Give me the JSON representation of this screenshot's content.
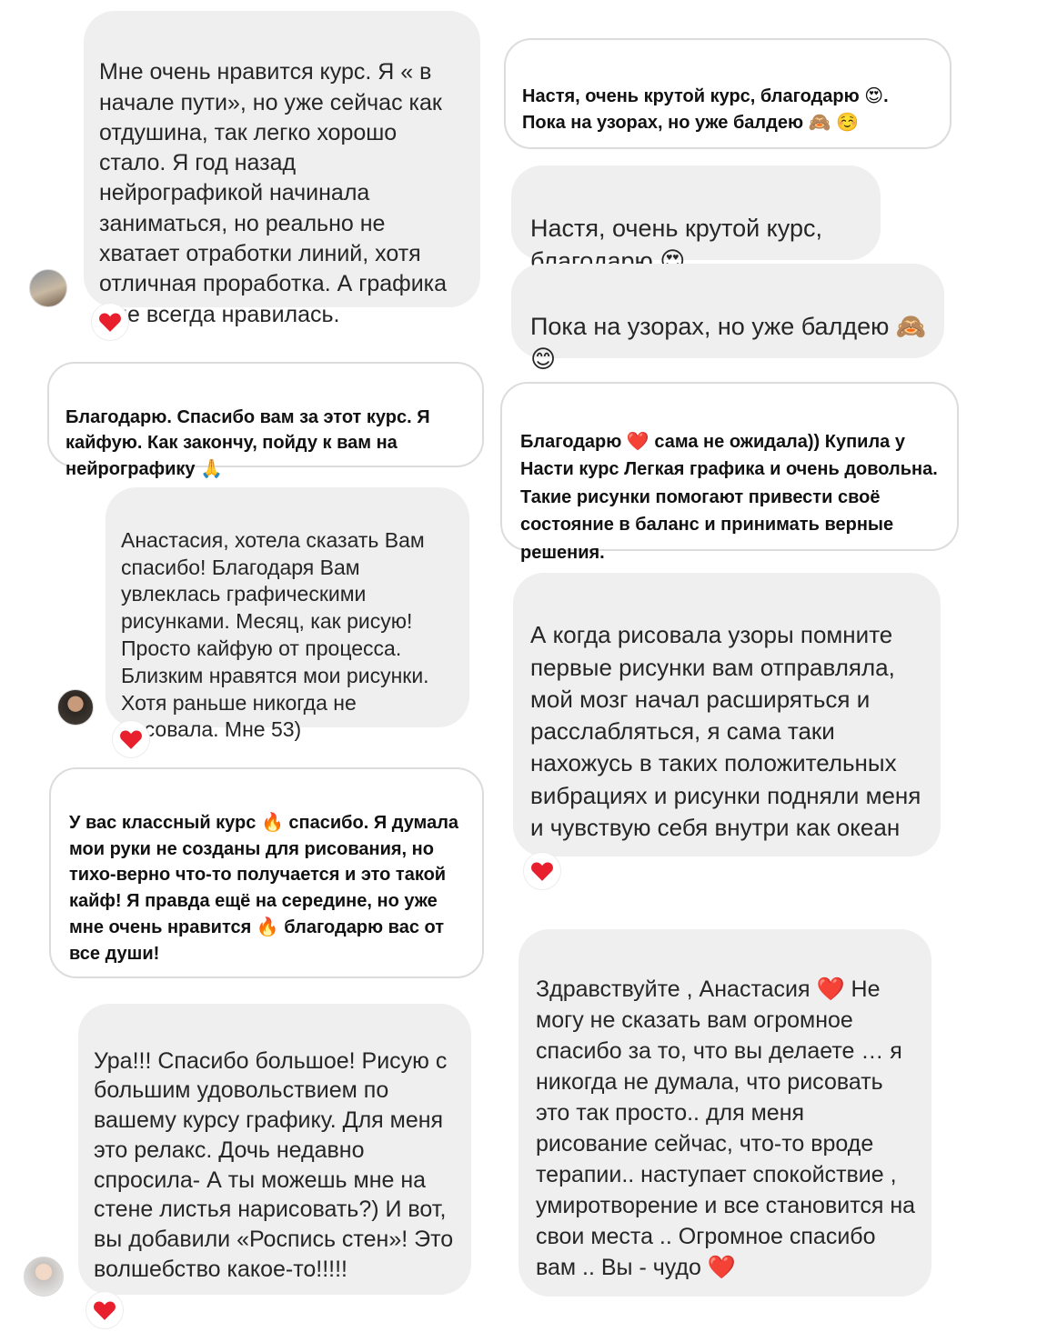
{
  "icons": {
    "like": "heart-icon",
    "avatar": "avatar"
  },
  "colors": {
    "heart": "#e8202e",
    "bubble": "#efefef",
    "outline_border": "#dcdcdc"
  },
  "messages": {
    "m1": "Мне очень нравится курс. Я « в начале пути», но уже сейчас как отдушина, так легко хорошо стало. Я год назад нейрографикой начинала заниматься, но реально не хватает отработки линий, хотя отличная проработка. А графика мне всегда нравилась.",
    "m2": "Настя, очень крутой курс, благодарю 😍. Пока на узорах, но уже балдею 🙈 ☺️",
    "m3": "Настя, очень крутой курс, благодарю 😍",
    "m4": "Пока на узорах, но уже балдею 🙈😊",
    "m5": "Благодарю. Спасибо вам за этот курс. Я кайфую. Как закончу, пойду к вам на нейрографику 🙏",
    "m6": "Благодарю ❤️ сама не ожидала)) Купила у Насти курс Легкая графика и очень довольна. Такие рисунки помогают привести своё состояние в баланс и принимать верные решения.",
    "m7": "Анастасия, хотела сказать Вам спасибо! Благодаря Вам увлеклась графическими рисунками. Месяц, как рисую! Просто кайфую от процесса. Близким нравятся мои рисунки. Хотя раньше никогда не рисовала. Мне 53)",
    "m8": "А когда рисовала узоры помните первые рисунки вам отправляла, мой мозг начал расширяться и расслабляться, я сама таки нахожусь в таких положительных вибрациях и рисунки подняли меня и чувствую себя внутри как океан",
    "m9": "У вас классный курс 🔥 спасибо. Я думала мои руки не созданы для рисования, но тихо-верно что-то получается и это такой кайф! Я правда ещё на середине, но уже мне очень нравится 🔥 благодарю вас от все души!",
    "m10": "Здравствуйте , Анастасия ❤️ Не могу не сказать вам огромное спасибо за то, что вы делаете … я никогда не думала, что рисовать это так просто.. для меня рисование сейчас, что-то вроде терапии.. наступает спокойствие , умиротворение и все становится на свои места .. Огромное спасибо вам .. Вы - чудо ❤️",
    "m11": "Ура!!! Спасибо большое! Рисую с большим удовольствием по вашему курсу графику. Для меня это релакс. Дочь недавно спросила- А ты можешь мне на стене листья нарисовать?) И вот, вы добавили «Роспись стен»! Это волшебство какое-то!!!!!"
  }
}
